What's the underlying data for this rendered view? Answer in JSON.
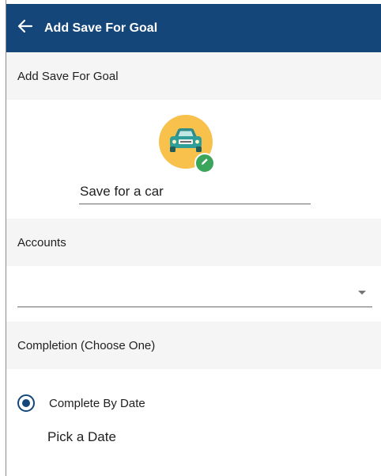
{
  "appbar": {
    "title": "Add Save For Goal",
    "back_icon": "arrow-left-icon",
    "color": "#14467a"
  },
  "sections": {
    "goal_header": "Add Save For Goal",
    "accounts_header": "Accounts",
    "completion_header": "Completion (Choose One)"
  },
  "goal": {
    "icon": "car-icon",
    "icon_bg_color": "#f7c14c",
    "edit_icon": "pencil-icon",
    "edit_badge_color": "#3aa55b",
    "name_value": "Save for a car"
  },
  "accounts": {
    "selected_value": ""
  },
  "completion": {
    "options": [
      {
        "label": "Complete By Date",
        "selected": true
      }
    ],
    "date_label": "Pick a Date"
  }
}
